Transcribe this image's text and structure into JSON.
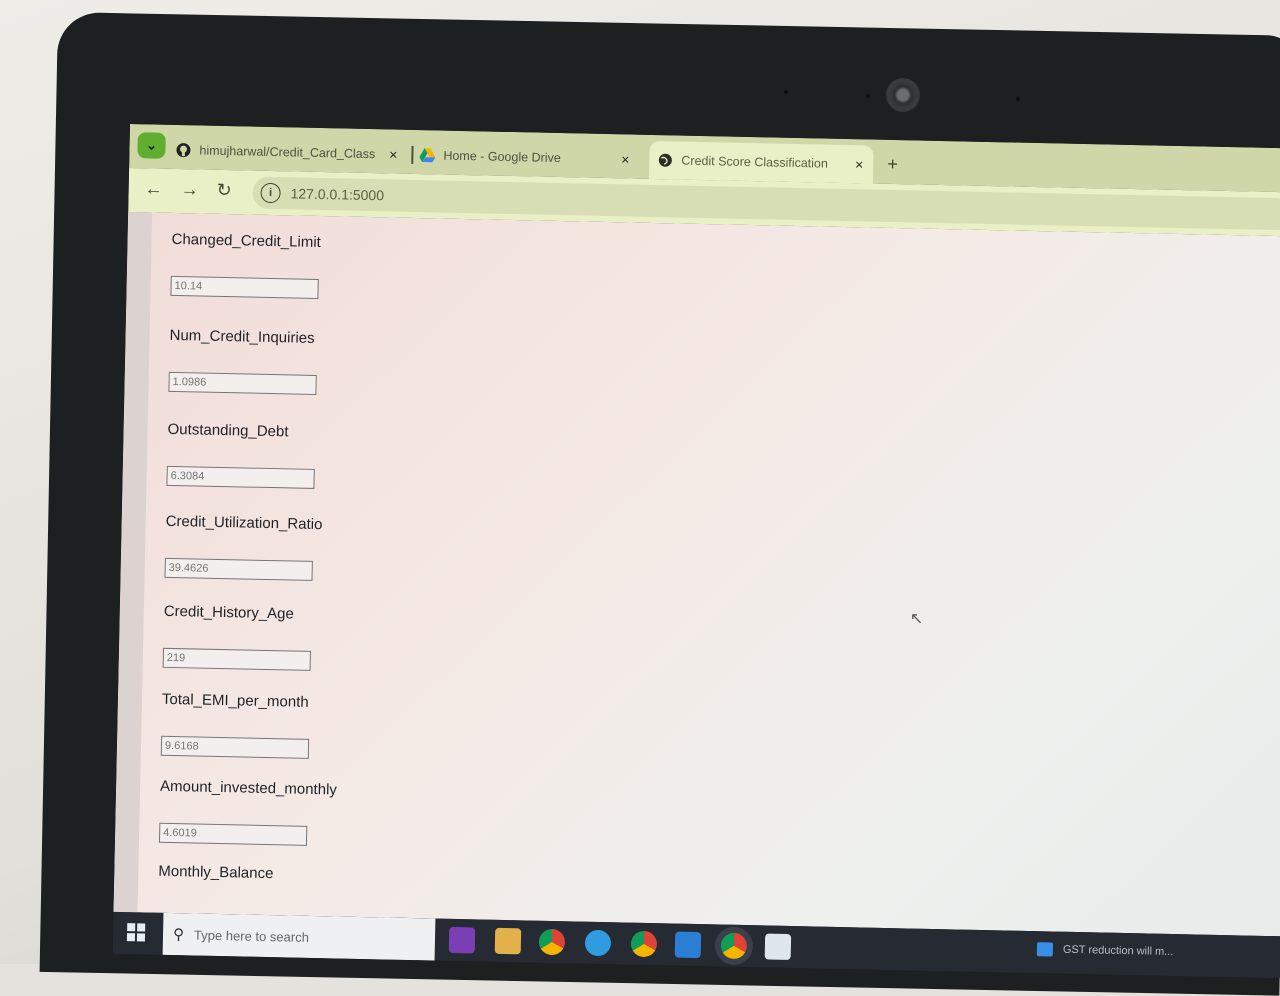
{
  "browser": {
    "tabs": [
      {
        "label": "himujharwal/Credit_Card_Class",
        "icon": "github-icon"
      },
      {
        "label": "Home - Google Drive",
        "icon": "google-drive-icon"
      },
      {
        "label": "Credit Score Classification",
        "icon": "globe-icon"
      }
    ],
    "tab_close": "×",
    "new_tab": "+",
    "url": "127.0.0.1:5000",
    "active_tab_index": 2
  },
  "form": {
    "fields": [
      {
        "label": "Changed_Credit_Limit",
        "placeholder": "10.14"
      },
      {
        "label": "Num_Credit_Inquiries",
        "placeholder": "1.0986"
      },
      {
        "label": "Outstanding_Debt",
        "placeholder": "6.3084"
      },
      {
        "label": "Credit_Utilization_Ratio",
        "placeholder": "39.4626"
      },
      {
        "label": "Credit_History_Age",
        "placeholder": "219"
      },
      {
        "label": "Total_EMI_per_month",
        "placeholder": "9.6168"
      },
      {
        "label": "Amount_invested_monthly",
        "placeholder": "4.6019"
      },
      {
        "label": "Monthly_Balance",
        "placeholder": ""
      }
    ]
  },
  "taskbar": {
    "search_placeholder": "Type here to search",
    "news_text": "GST reduction will m..."
  },
  "colors": {
    "tabbar": "#cfd6a8",
    "toolbar": "#e9f0c6",
    "taskbar": "#252a33"
  }
}
